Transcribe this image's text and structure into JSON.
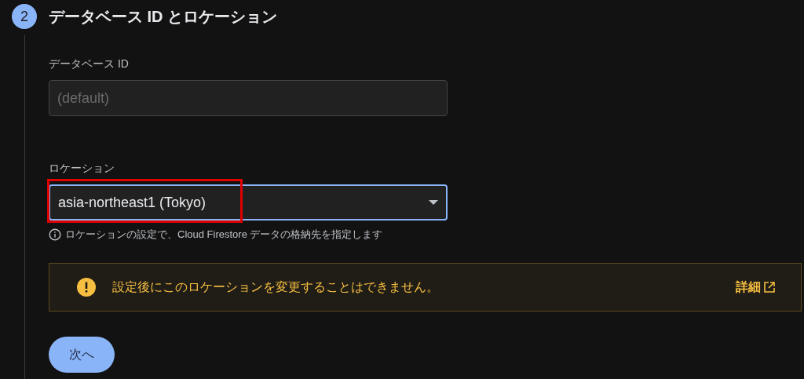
{
  "step": {
    "number": "2",
    "title": "データベース ID とロケーション"
  },
  "database_id": {
    "label": "データベース ID",
    "placeholder": "(default)",
    "disabled": true
  },
  "location": {
    "label": "ロケーション",
    "value": "asia-northeast1 (Tokyo)",
    "focused": true,
    "highlighted": true,
    "hint": "ロケーションの設定で、Cloud Firestore データの格納先を指定します"
  },
  "warning": {
    "message": "設定後にこのロケーションを変更することはできません。",
    "link": "詳細"
  },
  "next_button": {
    "label": "次へ"
  }
}
